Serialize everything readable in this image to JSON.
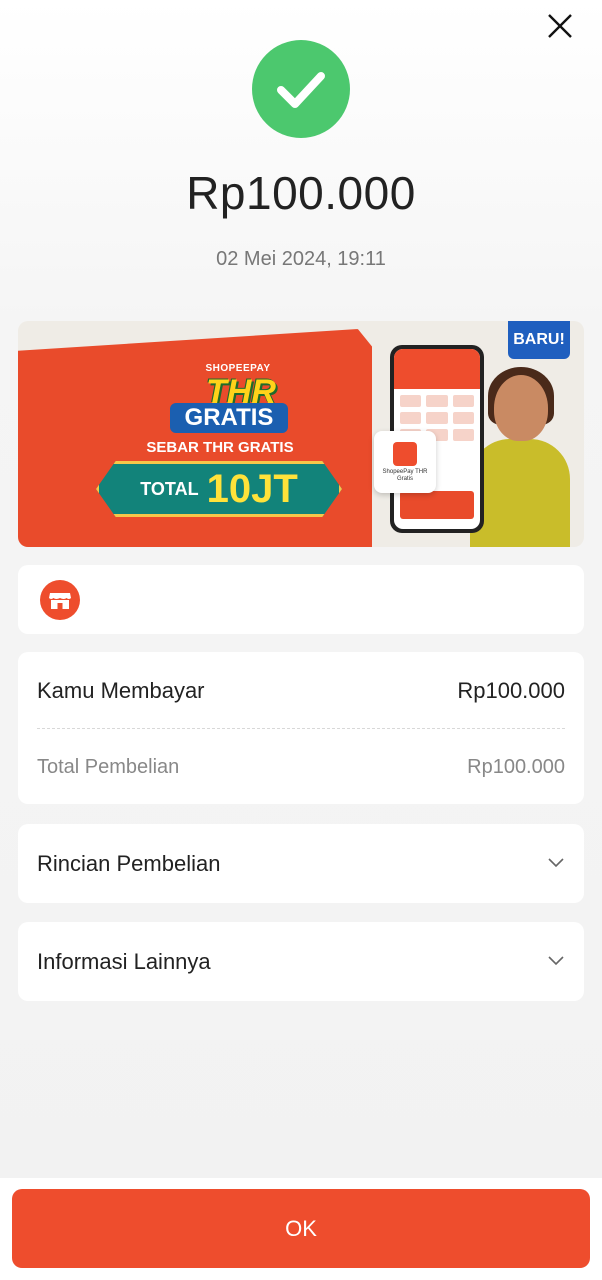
{
  "header": {
    "close_icon": "close-icon",
    "success_icon": "check-icon",
    "success_color": "#4cc86e"
  },
  "transaction": {
    "amount": "Rp100.000",
    "datetime": "02 Mei 2024, 19:11"
  },
  "banner": {
    "brand": "SHOPEEPAY",
    "headline": "THR",
    "headline2": "GRATIS",
    "subline": "SEBAR THR GRATIS",
    "total_label": "TOTAL",
    "total_value": "10JT",
    "badge": "BARU!",
    "card_text": "ShopeePay THR Gratis"
  },
  "merchant": {
    "icon": "store-icon",
    "name": ""
  },
  "payment": {
    "paid_label": "Kamu Membayar",
    "paid_value": "Rp100.000",
    "total_label": "Total Pembelian",
    "total_value": "Rp100.000"
  },
  "sections": [
    {
      "label": "Rincian Pembelian",
      "icon": "chevron-down-icon"
    },
    {
      "label": "Informasi Lainnya",
      "icon": "chevron-down-icon"
    }
  ],
  "footer": {
    "ok_label": "OK",
    "accent": "#ee4d2d"
  }
}
